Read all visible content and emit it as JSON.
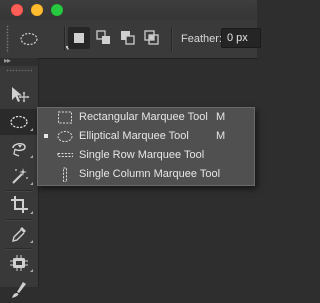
{
  "window": {
    "controls": [
      "close",
      "minimize",
      "maximize"
    ],
    "colors": {
      "close": "#ff5f57",
      "minimize": "#febc2e",
      "maximize": "#28c840"
    }
  },
  "options_bar": {
    "tool_preset_icon": "elliptical-marquee-icon",
    "selection_modes": [
      {
        "icon": "new-selection-icon",
        "active": true
      },
      {
        "icon": "add-to-selection-icon",
        "active": false
      },
      {
        "icon": "subtract-from-selection-icon",
        "active": false
      },
      {
        "icon": "intersect-selection-icon",
        "active": false
      }
    ],
    "feather_label": "Feather:",
    "feather_value": "0 px"
  },
  "toolbar": {
    "collapse_glyph": "▸▸",
    "tools": [
      {
        "name": "move-tool",
        "icon": "move-icon"
      },
      {
        "name": "marquee-tool",
        "icon": "elliptical-marquee-icon",
        "active": true
      },
      {
        "name": "lasso-tool",
        "icon": "lasso-icon"
      },
      {
        "name": "magic-wand-tool",
        "icon": "magic-wand-icon"
      },
      {
        "name": "crop-tool",
        "icon": "crop-icon"
      },
      {
        "name": "eyedropper-tool",
        "icon": "eyedropper-icon"
      },
      {
        "name": "healing-brush-tool",
        "icon": "healing-brush-icon"
      },
      {
        "name": "brush-tool",
        "icon": "brush-icon"
      }
    ]
  },
  "flyout": {
    "items": [
      {
        "label": "Rectangular Marquee Tool",
        "shortcut": "M",
        "icon": "rectangular-marquee-icon",
        "selected": false
      },
      {
        "label": "Elliptical Marquee Tool",
        "shortcut": "M",
        "icon": "elliptical-marquee-icon",
        "selected": true
      },
      {
        "label": "Single Row Marquee Tool",
        "shortcut": "",
        "icon": "single-row-marquee-icon",
        "selected": false
      },
      {
        "label": "Single Column Marquee Tool",
        "shortcut": "",
        "icon": "single-column-marquee-icon",
        "selected": false
      }
    ]
  }
}
